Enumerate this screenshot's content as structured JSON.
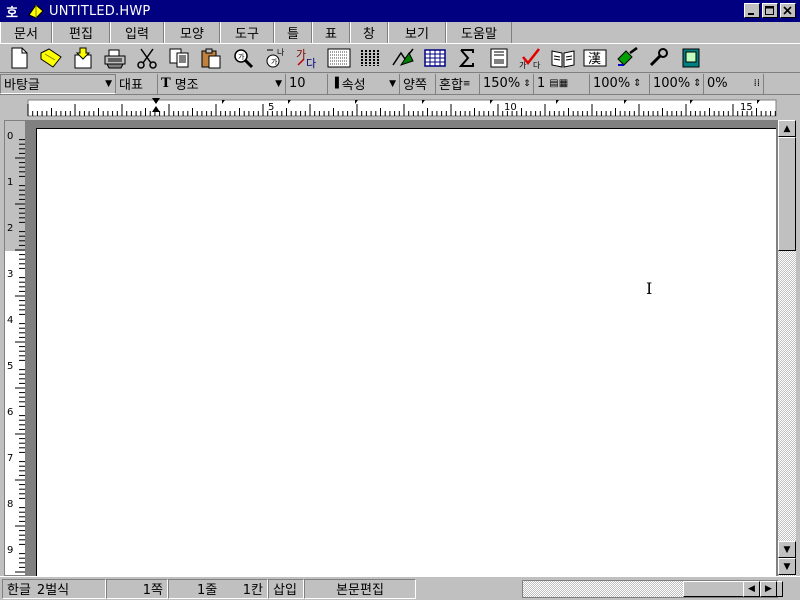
{
  "window": {
    "title": "UNTITLED.HWP",
    "app_icon_glyph": "호"
  },
  "menu": [
    {
      "label": "문서",
      "width": 52
    },
    {
      "label": "편집",
      "width": 58
    },
    {
      "label": "입력",
      "width": 54
    },
    {
      "label": "모양",
      "width": 56
    },
    {
      "label": "도구",
      "width": 54
    },
    {
      "label": "틀",
      "width": 38
    },
    {
      "label": "표",
      "width": 38
    },
    {
      "label": "창",
      "width": 38
    },
    {
      "label": "보기",
      "width": 58
    },
    {
      "label": "도움말",
      "width": 66
    }
  ],
  "toolbar_icons": [
    "new-document-icon",
    "open-folder-icon",
    "save-icon",
    "print-icon",
    "cut-icon",
    "copy-icon",
    "paste-icon",
    "find-icon",
    "replace-icon",
    "font-style-icon",
    "page-layout-icon",
    "columns-icon",
    "drawing-icon",
    "table-icon",
    "sum-icon",
    "page-icon",
    "spellcheck-icon",
    "dictionary-icon",
    "hanja-icon",
    "brush-icon",
    "wrench-icon",
    "calculator-icon"
  ],
  "toolbar_labels": {
    "replace_top": "나",
    "replace_bottom": "가",
    "font_a": "가",
    "font_b": "다",
    "spell_a": "가",
    "spell_b": "다",
    "hanja": "漢"
  },
  "format": {
    "style": "바탕글",
    "font_group": "대표",
    "font_type_glyph": "T",
    "font": "명조",
    "size": "10",
    "attr": "속성",
    "align1": "양쪽",
    "align2": "혼합",
    "line_spacing": "150%",
    "columns": "1",
    "zoom1": "100%",
    "zoom2": "100%",
    "zoom3": "0%"
  },
  "ruler": {
    "marks": [
      "5",
      "10",
      "15"
    ]
  },
  "vruler": {
    "marks": [
      "0",
      "1",
      "2",
      "3",
      "4",
      "5",
      "6",
      "7",
      "8",
      "9"
    ]
  },
  "status": {
    "lang": "한글",
    "input_mode": "2벌식",
    "page": "1쪽",
    "line": "1줄",
    "column": "1칸",
    "insert_mode": "삽입",
    "edit_mode": "본문편집"
  },
  "colors": {
    "titlebar": "#000080",
    "chrome": "#c0c0c0",
    "page": "#ffffff"
  }
}
